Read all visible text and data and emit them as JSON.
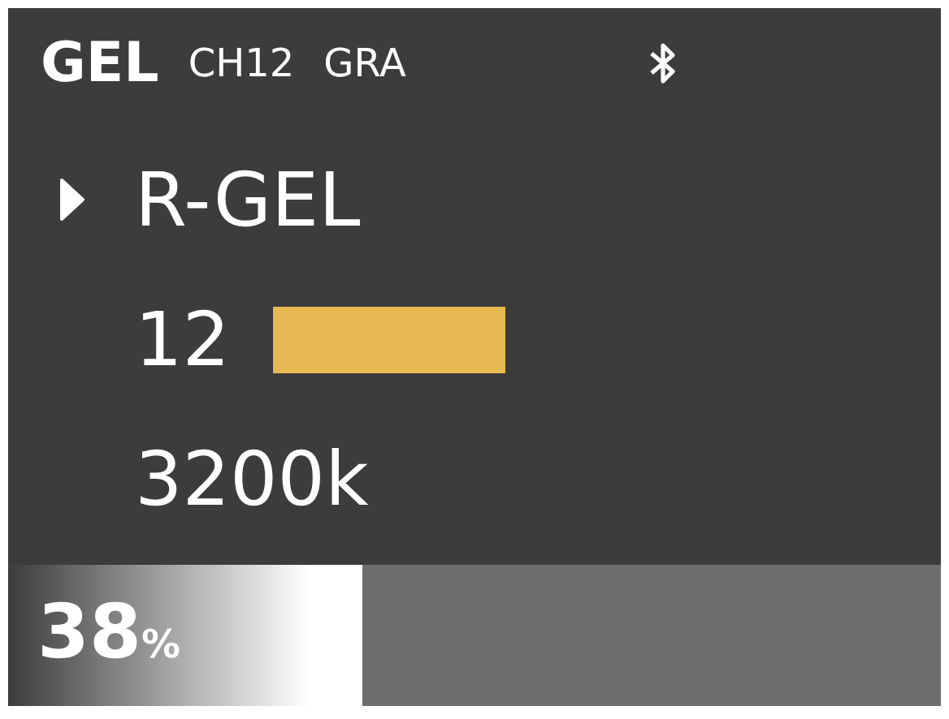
{
  "header": {
    "title": "GEL",
    "channel": "CH12",
    "mode": "GRA"
  },
  "items": [
    {
      "label": "R-GEL",
      "kind": "text",
      "selected": true
    },
    {
      "label": "12",
      "kind": "swatch",
      "color": "#e8b852",
      "selected": false
    },
    {
      "label": "3200k",
      "kind": "text",
      "selected": false
    }
  ],
  "footer": {
    "value": "38",
    "unit": "%",
    "level": 0.38
  }
}
